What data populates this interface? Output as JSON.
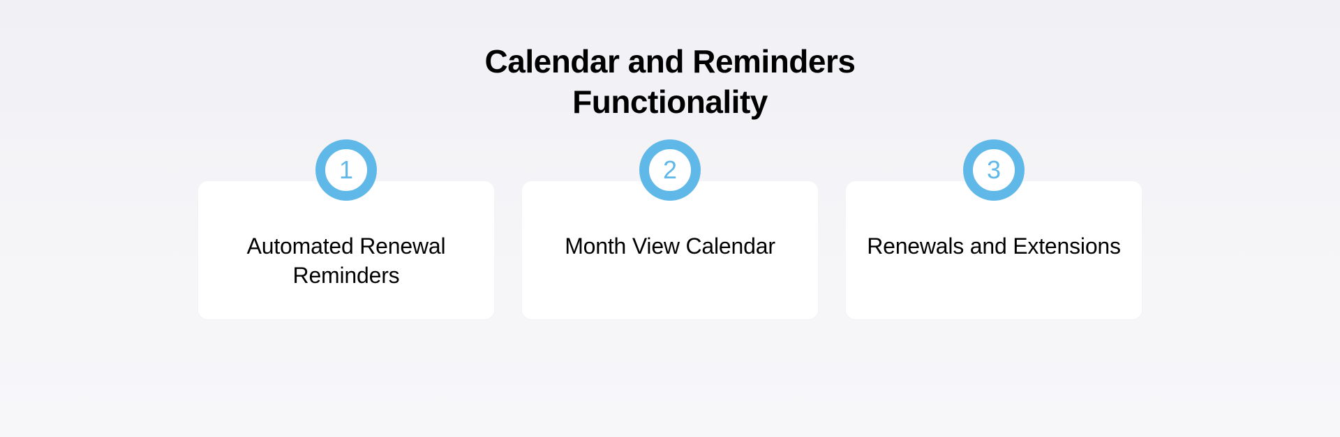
{
  "title": "Calendar and Reminders Functionality",
  "cards": [
    {
      "number": "1",
      "label": "Automated Renewal Reminders"
    },
    {
      "number": "2",
      "label": "Month View Calendar"
    },
    {
      "number": "3",
      "label": "Renewals and Extensions"
    }
  ]
}
